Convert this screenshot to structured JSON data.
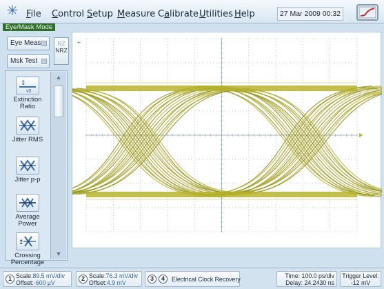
{
  "menubar": {
    "items": [
      {
        "label": "File",
        "underline": "F"
      },
      {
        "label": "Control",
        "underline": "C"
      },
      {
        "label": "Setup",
        "underline": "S"
      },
      {
        "label": "Measure",
        "underline": "M"
      },
      {
        "label": "Calibrate",
        "underline": "a"
      },
      {
        "label": "Utilities",
        "underline": "U"
      },
      {
        "label": "Help",
        "underline": "H"
      }
    ],
    "datetime": "27 Mar 2009  00:32"
  },
  "mode": "Eye/Mask Mode",
  "left_panel": {
    "eye_meas": "Eye Meas",
    "msk_test": "Msk Test",
    "rz": "RZ",
    "nrz": "NRZ",
    "measurements": [
      {
        "label": "Extinction Ratio",
        "icon": "extinction-ratio-icon"
      },
      {
        "label": "Jitter RMS",
        "icon": "jitter-rms-icon"
      },
      {
        "label": "Jitter p-p",
        "icon": "jitter-pp-icon"
      },
      {
        "label": "Average Power",
        "icon": "average-power-icon"
      },
      {
        "label": "Crossing Percentage",
        "icon": "crossing-percentage-icon"
      }
    ]
  },
  "colors": {
    "trace": "#b5b12a",
    "trace_dark": "#8c8a18",
    "grid": "#8fa6bb",
    "accent": "#3060b0"
  },
  "status": {
    "ch1": {
      "num": "1",
      "scale": "89.5 mV/div",
      "offset": "-600 µV"
    },
    "ch2": {
      "num": "2",
      "scale": "76.3 mV/div",
      "offset": "4.9 mV"
    },
    "ch3": "3",
    "ch4": "4",
    "clock": "Electrical Clock Recovery",
    "time": "100.0 ps/div",
    "delay": "24.2430 ns",
    "trigger_label": "Trigger Level:",
    "trigger_value": "-12 mV"
  },
  "labels": {
    "scale": "Scale:",
    "offset": "Offset:",
    "time": "Time:",
    "delay": "Delay:"
  }
}
